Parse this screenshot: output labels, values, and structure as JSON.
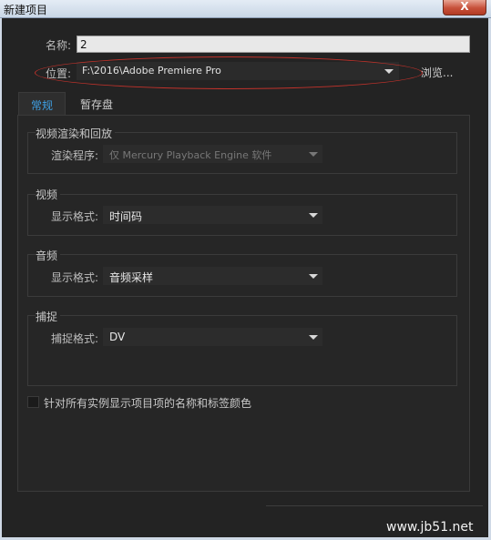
{
  "window": {
    "title": "新建项目",
    "close_label": "X"
  },
  "form": {
    "name_label": "名称:",
    "name_value": "2",
    "location_label": "位置:",
    "location_value": "F:\\2016\\Adobe Premiere Pro",
    "browse_label": "浏览..."
  },
  "tabs": [
    {
      "label": "常规",
      "active": true
    },
    {
      "label": "暂存盘",
      "active": false
    }
  ],
  "groups": {
    "video_rendering": {
      "title": "视频渲染和回放",
      "renderer_label": "渲染程序:",
      "renderer_value": "仅 Mercury Playback Engine 软件"
    },
    "video": {
      "title": "视频",
      "display_format_label": "显示格式:",
      "display_format_value": "时间码"
    },
    "audio": {
      "title": "音频",
      "display_format_label": "显示格式:",
      "display_format_value": "音频采样"
    },
    "capture": {
      "title": "捕捉",
      "capture_format_label": "捕捉格式:",
      "capture_format_value": "DV"
    }
  },
  "checkbox_label": "针对所有实例显示项目项的名称和标签颜色",
  "watermark": "www.jb51.net",
  "colors": {
    "accent_tab": "#3ea0e4",
    "annotation_red": "#c0322b",
    "background": "#232323"
  }
}
